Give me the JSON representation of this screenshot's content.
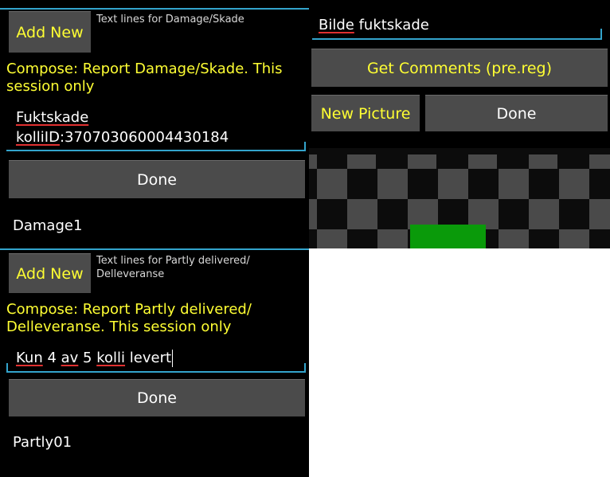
{
  "damage_panel": {
    "add_new_label": "Add New",
    "header_text": "Text lines for Damage/Skade",
    "compose_text": "Compose: Report Damage/Skade. This session only",
    "input_line1": "Fuktskade",
    "input_line2_prefix": "kolliID",
    "input_line2_rest": ":370703060004430184",
    "done_label": "Done",
    "list_item": "Damage1"
  },
  "picture_panel": {
    "input_word1": "Bilde",
    "input_word2": " fuktskade",
    "get_comments_label": "Get Comments (pre.reg)",
    "new_picture_label": "New Picture",
    "done_label": "Done"
  },
  "partly_panel": {
    "add_new_label": "Add New",
    "header_text_line1": "Text lines for Partly delivered/",
    "header_text_line2": "Delleveranse",
    "compose_line1": "Compose: Report Partly delivered/",
    "compose_line2": "Delleveranse. This session only",
    "input_w1": "Kun",
    "input_w2": " 4 ",
    "input_w3": "av",
    "input_w4": " 5 ",
    "input_w5": "kolli",
    "input_w6": " levert",
    "done_label": "Done",
    "list_item": "Partly01"
  },
  "colors": {
    "accent": "#ffff33",
    "underline_blue": "#33a4cc",
    "spell_red": "#e03030",
    "green": "#0a9a0a"
  }
}
